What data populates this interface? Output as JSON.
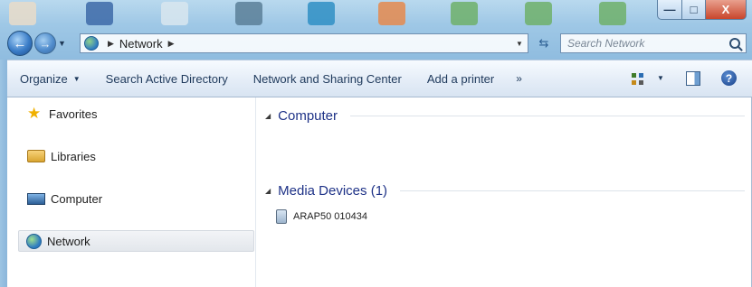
{
  "window": {
    "controls": {
      "minimize": "—",
      "maximize": "□",
      "close": "X"
    }
  },
  "navigation": {
    "back_icon": "back-arrow-icon",
    "forward_icon": "forward-arrow-icon",
    "address_path": [
      "Network"
    ],
    "address_location_icon": "network-globe-icon",
    "search_placeholder": "Search Network"
  },
  "toolbar": {
    "organize": "Organize",
    "search_ad": "Search Active Directory",
    "network_sharing": "Network and Sharing Center",
    "add_printer": "Add a printer",
    "more": "»"
  },
  "sidebar": {
    "items": [
      {
        "label": "Favorites",
        "icon": "star-icon",
        "selected": false
      },
      {
        "label": "Libraries",
        "icon": "library-icon",
        "selected": false
      },
      {
        "label": "Computer",
        "icon": "computer-icon",
        "selected": false
      },
      {
        "label": "Network",
        "icon": "network-icon",
        "selected": true
      }
    ]
  },
  "content": {
    "groups": [
      {
        "title": "Computer",
        "items": []
      },
      {
        "title": "Media Devices (1)",
        "items": [
          {
            "name": "ARAP50 010434",
            "icon": "media-device-icon"
          }
        ]
      }
    ]
  }
}
